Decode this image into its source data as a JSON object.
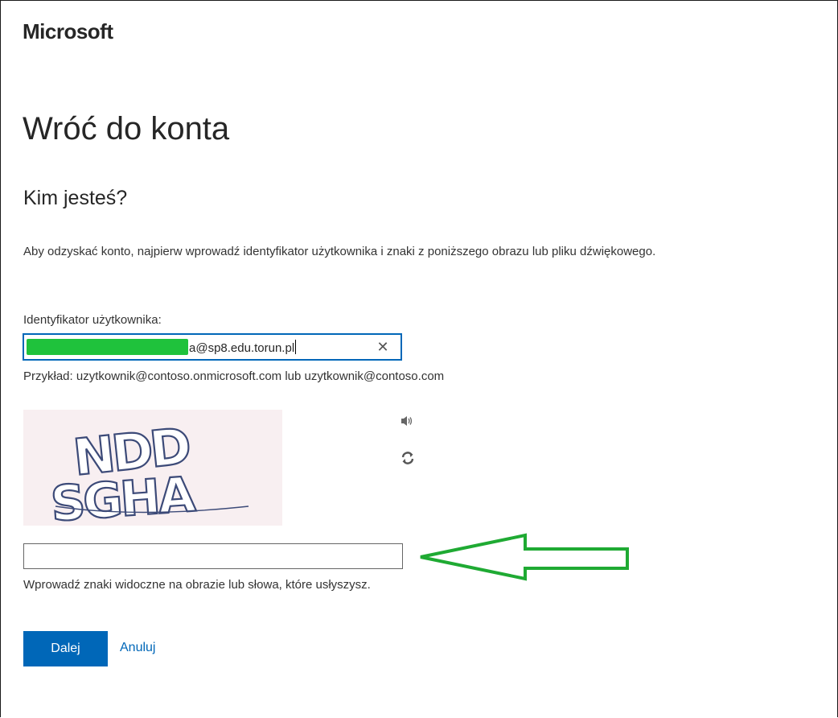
{
  "brand": "Microsoft",
  "title": "Wróć do konta",
  "subtitle": "Kim jesteś?",
  "instructions": "Aby odzyskać konto, najpierw wprowadź identyfikator użytkownika i znaki z poniższego obrazu lub pliku dźwiękowego.",
  "user_id": {
    "label": "Identyfikator użytkownika:",
    "visible_value": "a@sp8.edu.torun.pl",
    "clear_glyph": "✕"
  },
  "example": "Przykład: uzytkownik@contoso.onmicrosoft.com lub uzytkownik@contoso.com",
  "captcha": {
    "line1": "NDD",
    "line2": "SGHA",
    "audio_icon": "speaker-icon",
    "refresh_icon": "refresh-icon"
  },
  "captcha_input": {
    "value": "",
    "placeholder": ""
  },
  "hint": "Wprowadź znaki widoczne na obrazie lub słowa, które usłyszysz.",
  "buttons": {
    "next": "Dalej",
    "cancel": "Anuluj"
  },
  "colors": {
    "accent": "#0067b8",
    "redaction": "#1fc23c",
    "annotation_arrow": "#1faa33",
    "captcha_background": "#f8eff1",
    "captcha_text": "#3c4a78"
  }
}
